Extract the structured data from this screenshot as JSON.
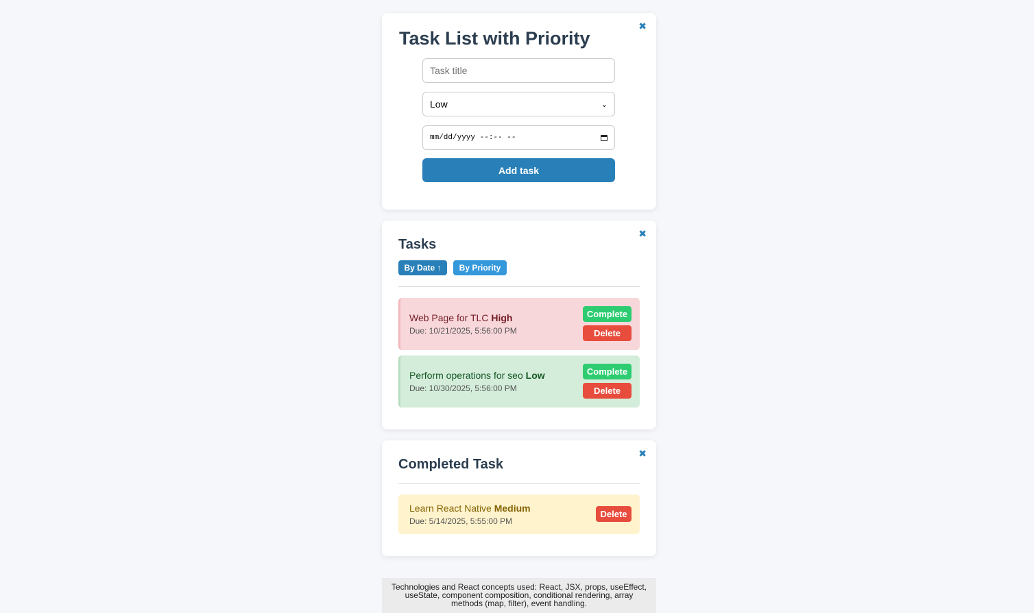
{
  "add_card": {
    "title": "Task List with Priority",
    "close": "✖",
    "task_input_placeholder": "Task title",
    "priority_selected": "Low",
    "date_placeholder": "mm/dd/yyyy --:-- --",
    "add_button": "Add task"
  },
  "tasks_card": {
    "title": "Tasks",
    "close": "✖",
    "sort_by_date": "By Date ↑",
    "sort_by_priority": "By Priority",
    "items": [
      {
        "name": "Web Page for TLC",
        "priority": "High",
        "due": "Due: 10/21/2025, 5:56:00 PM",
        "complete_label": "Complete",
        "delete_label": "Delete"
      },
      {
        "name": "Perform operations for seo",
        "priority": "Low",
        "due": "Due: 10/30/2025, 5:56:00 PM",
        "complete_label": "Complete",
        "delete_label": "Delete"
      }
    ]
  },
  "completed_card": {
    "title": "Completed Task",
    "close": "✖",
    "items": [
      {
        "name": "Learn React Native",
        "priority": "Medium",
        "due": "Due: 5/14/2025, 5:55:00 PM",
        "delete_label": "Delete"
      }
    ]
  },
  "footer": {
    "text": "Technologies and React concepts used: React, JSX, props, useEffect, useState, component composition, conditional rendering, array methods (map, filter), event handling."
  },
  "colors": {
    "accent": "#2980b9",
    "high_bg": "#f8d7da",
    "low_bg": "#d4edda",
    "medium_bg": "#fff3cd",
    "complete": "#2ecc71",
    "delete": "#e74c3c"
  }
}
